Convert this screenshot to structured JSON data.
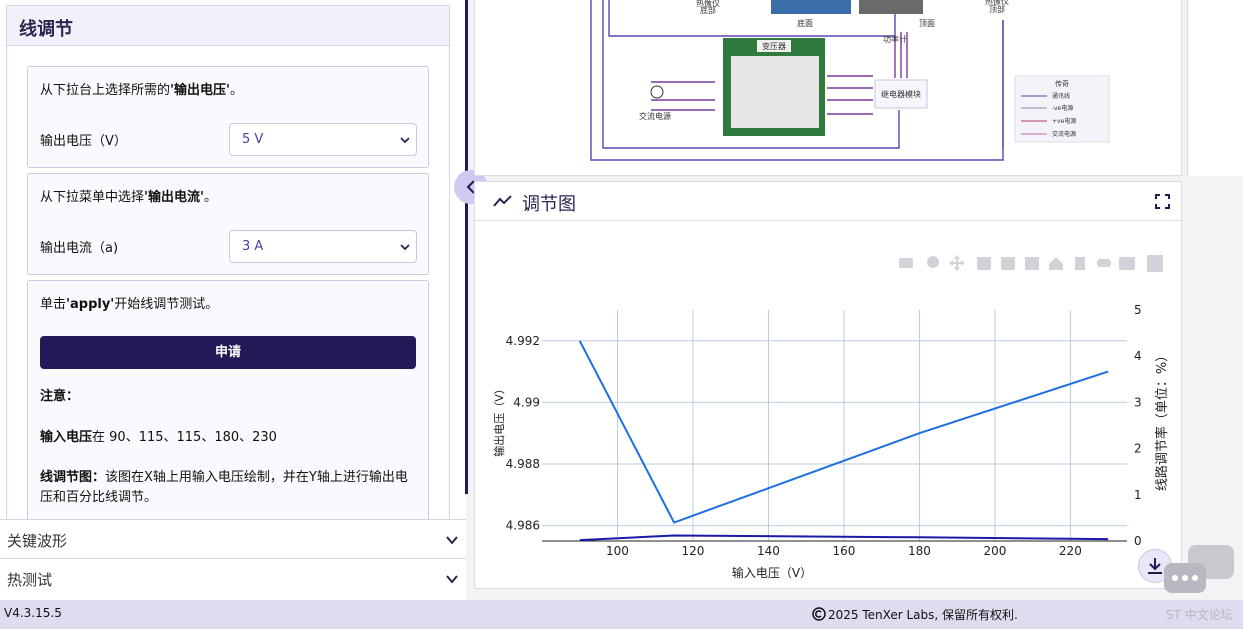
{
  "sidebar": {
    "section_title": "线调节",
    "card1": {
      "instruction_prefix": "从下拉台上选择所需的",
      "instruction_bold": "'输出电压'",
      "instruction_suffix": "。",
      "label": "输出电压（V）",
      "selected": "5 V"
    },
    "card2": {
      "instruction_prefix": "从下拉菜单中选择",
      "instruction_bold": "'输出电流'",
      "instruction_suffix": "。",
      "label": "输出电流（a)",
      "selected": "3 A"
    },
    "card3": {
      "instruction_prefix": "单击",
      "instruction_bold": "'apply'",
      "instruction_suffix": "开始线调节测试。",
      "apply_label": "申请"
    },
    "notes": {
      "title": "注意：",
      "input_bold": "输入电压",
      "input_text": "在 90、115、115、180、230",
      "graph_bold": "线调节图：",
      "graph_text": "该图在X轴上用输入电压绘制，并在Y轴上进行输出电压和百分比线调节。"
    },
    "accordion": [
      {
        "label": "关键波形"
      },
      {
        "label": "热测试"
      }
    ]
  },
  "diagram": {
    "labels": {
      "top_left": "热像仪\n底部",
      "bottom_label": "底面",
      "top_label": "顶面",
      "top_right": "热像仪\n顶部",
      "power_meter": "功率计",
      "transformer": "变压器",
      "relay": "继电器模块",
      "ac_source": "交流电源"
    },
    "legend": {
      "title": "传奇",
      "items": [
        "通讯线",
        "-ve电源",
        "+ve电源",
        "交流电源"
      ]
    },
    "legend_colors": [
      "#5a46b0",
      "#8a8aa0",
      "#b43a5a",
      "#c06aa0"
    ]
  },
  "chart_panel": {
    "title": "调节图",
    "icons": [
      "line-chart-icon",
      "fullscreen-icon",
      "camera-icon",
      "zoom-icon",
      "pan-icon",
      "zoom-in-icon",
      "zoom-out-icon",
      "autoscale-icon",
      "home-icon",
      "spike-icon",
      "hover-closest-icon",
      "hover-compare-icon",
      "plotly-logo-icon",
      "download-icon"
    ]
  },
  "chart_data": {
    "type": "line",
    "xlabel": "输入电压（V）",
    "ylabel": "输出电压（V）",
    "y2label": "线路调节率（单位：%）",
    "xlim": [
      80,
      235
    ],
    "ylim": [
      4.9855,
      4.993
    ],
    "y2lim": [
      0,
      5
    ],
    "xticks": [
      100,
      120,
      140,
      160,
      180,
      200,
      220
    ],
    "yticks": [
      "4.986",
      "4.988",
      "4.99",
      "4.992"
    ],
    "y2ticks": [
      0,
      1,
      2,
      3,
      4,
      5
    ],
    "series": [
      {
        "name": "",
        "axis": "y",
        "color": "#1f6fe0",
        "x": [
          90,
          115,
          180,
          230
        ],
        "y": [
          4.992,
          4.9861,
          4.989,
          4.991
        ]
      },
      {
        "name": "",
        "axis": "y2",
        "color": "#1a1aa8",
        "x": [
          90,
          115,
          180,
          230
        ],
        "y": [
          0.02,
          0.12,
          0.08,
          0.04
        ]
      }
    ],
    "grid": true
  },
  "footer": {
    "version": "V4.3.15.5",
    "copyright": "2025 TenXer Labs, 保留所有权利.",
    "forum": "ST 中文论坛"
  }
}
